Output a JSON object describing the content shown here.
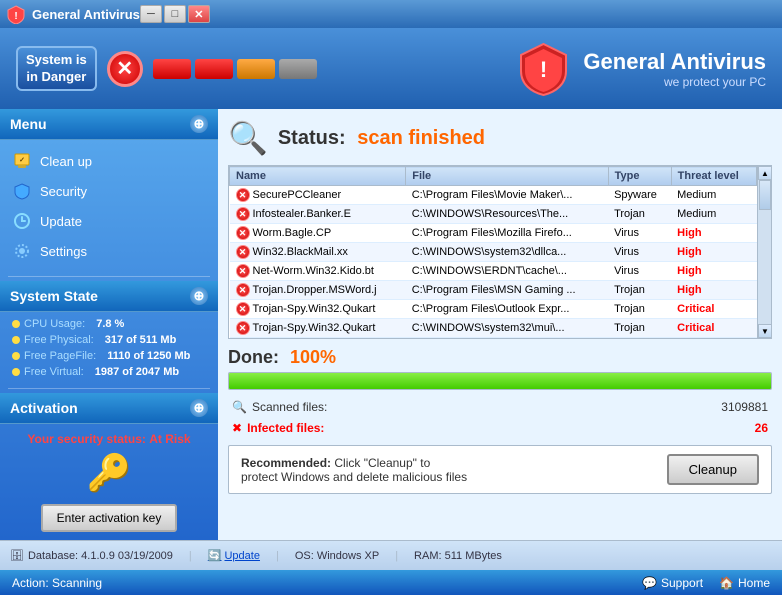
{
  "window": {
    "title": "General Antivirus",
    "min": "─",
    "max": "□",
    "close": "✕"
  },
  "topbar": {
    "danger_line1": "System is",
    "danger_line2": "in Danger",
    "brand_name": "General Antivirus",
    "brand_tagline": "we protect your PC"
  },
  "sidebar": {
    "menu_label": "Menu",
    "items": [
      {
        "label": "Clean up",
        "icon": "🧹"
      },
      {
        "label": "Security",
        "icon": "🛡"
      },
      {
        "label": "Update",
        "icon": "🔄"
      },
      {
        "label": "Settings",
        "icon": "⚙"
      }
    ],
    "system_state_label": "System State",
    "stats": [
      {
        "label": "CPU Usage:",
        "value": "7.8 %"
      },
      {
        "label": "Free Physical:",
        "value": "317 of 511 Mb"
      },
      {
        "label": "Free PageFile:",
        "value": "1110 of 1250 Mb"
      },
      {
        "label": "Free Virtual:",
        "value": "1987 of 2047 Mb"
      }
    ],
    "activation_label": "Activation",
    "security_status": "Your security status:",
    "risk_label": "At Risk",
    "activate_btn": "Enter activation key"
  },
  "main": {
    "status_prefix": "Status:",
    "status_value": "scan finished",
    "table": {
      "columns": [
        "Name",
        "File",
        "Type",
        "Threat level"
      ],
      "rows": [
        {
          "name": "SecurePCCleaner",
          "file": "C:\\Program Files\\Movie Maker\\...",
          "type": "Spyware",
          "threat": "Medium",
          "threat_class": "medium"
        },
        {
          "name": "Infostealer.Banker.E",
          "file": "C:\\WINDOWS\\Resources\\The...",
          "type": "Trojan",
          "threat": "Medium",
          "threat_class": "medium"
        },
        {
          "name": "Worm.Bagle.CP",
          "file": "C:\\Program Files\\Mozilla Firefo...",
          "type": "Virus",
          "threat": "High",
          "threat_class": "high"
        },
        {
          "name": "Win32.BlackMail.xx",
          "file": "C:\\WINDOWS\\system32\\dllca...",
          "type": "Virus",
          "threat": "High",
          "threat_class": "high"
        },
        {
          "name": "Net-Worm.Win32.Kido.bt",
          "file": "C:\\WINDOWS\\ERDNT\\cache\\...",
          "type": "Virus",
          "threat": "High",
          "threat_class": "high"
        },
        {
          "name": "Trojan.Dropper.MSWord.j",
          "file": "C:\\Program Files\\MSN Gaming ...",
          "type": "Trojan",
          "threat": "High",
          "threat_class": "high"
        },
        {
          "name": "Trojan-Spy.Win32.Qukart",
          "file": "C:\\Program Files\\Outlook Expr...",
          "type": "Trojan",
          "threat": "Critical",
          "threat_class": "critical"
        },
        {
          "name": "Trojan-Spy.Win32.Qukart",
          "file": "C:\\WINDOWS\\system32\\mui\\...",
          "type": "Trojan",
          "threat": "Critical",
          "threat_class": "critical"
        }
      ]
    },
    "done_label": "Done:",
    "done_percent": "100%",
    "progress": 100,
    "scanned_label": "Scanned files:",
    "scanned_value": "3109881",
    "infected_label": "Infected files:",
    "infected_value": "26",
    "recommendation_prefix": "Recommended:",
    "recommendation_text": "Click \"Cleanup\" to\nprotect Windows and delete malicious files",
    "cleanup_btn": "Cleanup"
  },
  "bottombar": {
    "db_icon": "🗄",
    "db_text": "Database: 4.1.0.9  03/19/2009",
    "update_icon": "🔄",
    "update_text": "Update",
    "os_text": "OS: Windows XP",
    "ram_text": "RAM: 511 MBytes"
  },
  "actionbar": {
    "action_text": "Action: Scanning",
    "support_text": "Support",
    "home_text": "Home"
  }
}
